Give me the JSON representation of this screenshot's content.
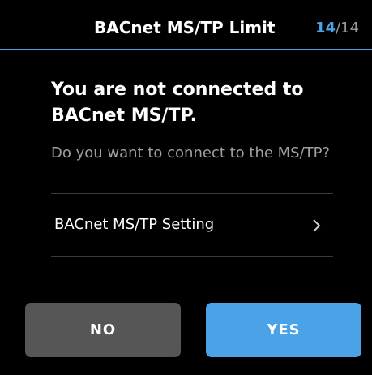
{
  "header": {
    "title": "BACnet MS/TP Limit",
    "page_current": "14",
    "page_separator": "/",
    "page_total": "14"
  },
  "dialog": {
    "heading": "You are not connected to BACnet MS/TP.",
    "subtext": "Do you want to connect to the MS/TP?"
  },
  "setting": {
    "label": "BACnet MS/TP Setting",
    "icon": "chevron-right-icon"
  },
  "buttons": {
    "no_label": "NO",
    "yes_label": "YES"
  },
  "colors": {
    "accent": "#4aa3e6",
    "background": "#000000",
    "secondary_button": "#565656",
    "muted_text": "#a0a0a0"
  }
}
